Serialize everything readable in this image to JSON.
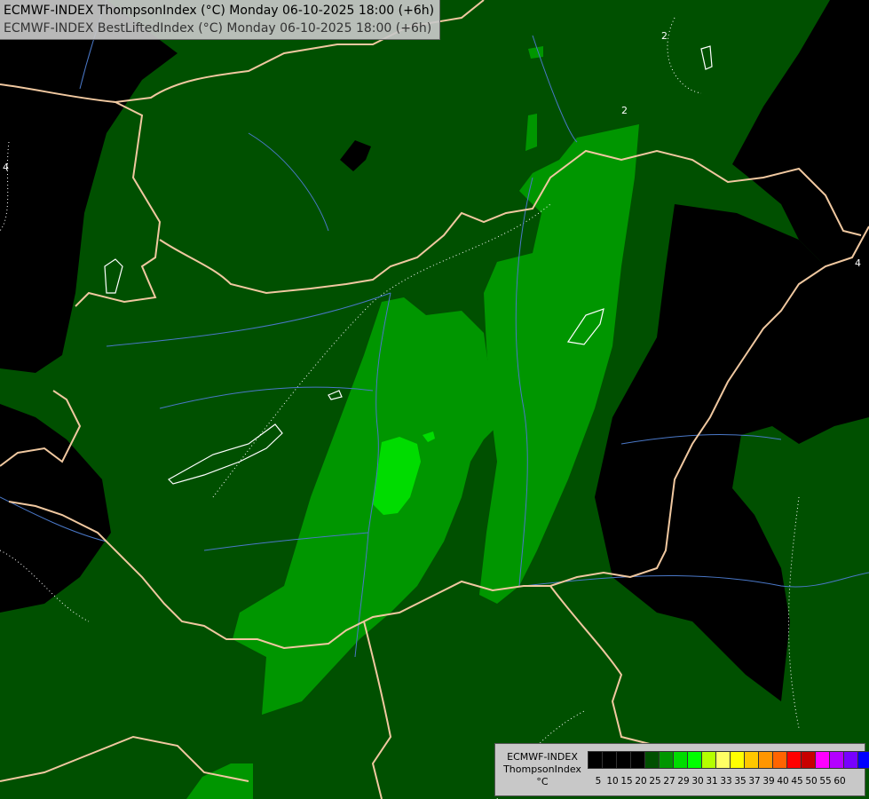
{
  "header": {
    "line1": "ECMWF-INDEX ThompsonIndex (°C) Monday 06-10-2025 18:00 (+6h)",
    "line2": "ECMWF-INDEX BestLiftedIndex (°C) Monday 06-10-2025 18:00 (+6h)"
  },
  "contour_labels": [
    "2",
    "2",
    "4",
    "4"
  ],
  "legend": {
    "line1": "ECMWF-INDEX",
    "line2": "ThompsonIndex",
    "line3": "°C",
    "ticks": [
      "5",
      "10",
      "15",
      "20",
      "25",
      "27",
      "29",
      "30",
      "31",
      "33",
      "35",
      "37",
      "39",
      "40",
      "45",
      "50",
      "55",
      "60"
    ],
    "colors": [
      "#000000",
      "#000000",
      "#000000",
      "#000000",
      "#005000",
      "#009600",
      "#00dc00",
      "#00ff00",
      "#b4ff00",
      "#ffff64",
      "#ffff00",
      "#ffc800",
      "#ff9600",
      "#ff6400",
      "#ff0000",
      "#c80000",
      "#ff00ff",
      "#b400ff",
      "#7800ff",
      "#0000ff"
    ]
  }
}
